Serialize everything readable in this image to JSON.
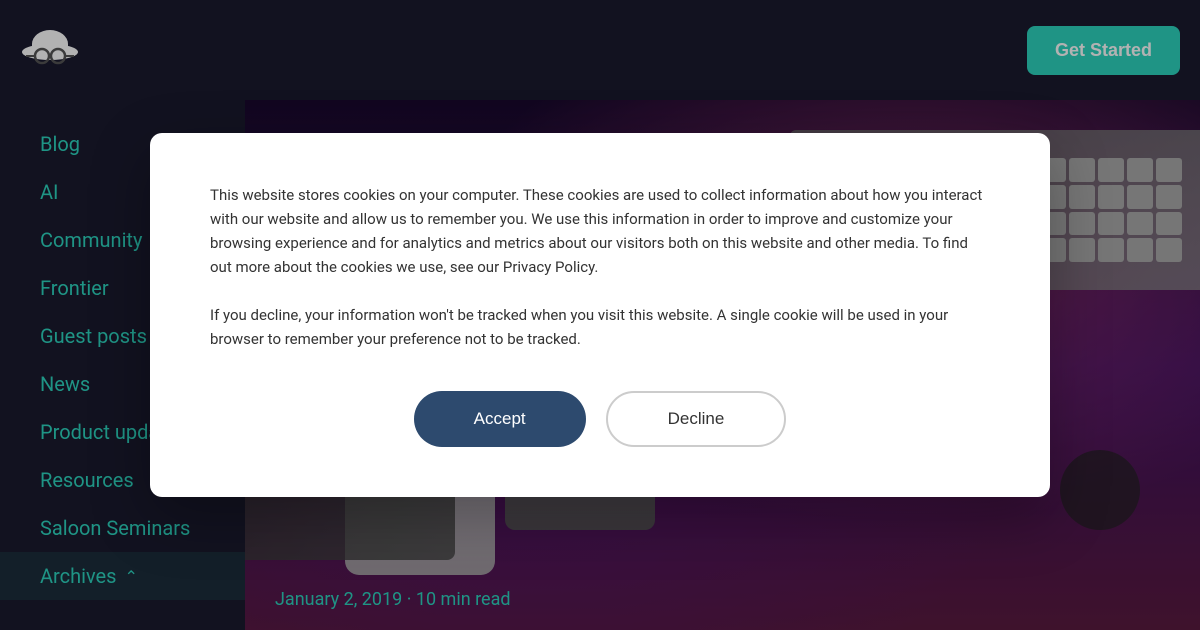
{
  "header": {
    "get_started_label": "Get Started"
  },
  "sidebar": {
    "items": [
      {
        "id": "blog",
        "label": "Blog"
      },
      {
        "id": "ai",
        "label": "AI"
      },
      {
        "id": "community",
        "label": "Community"
      },
      {
        "id": "frontier",
        "label": "Frontier"
      },
      {
        "id": "guest-posts",
        "label": "Guest posts"
      },
      {
        "id": "news",
        "label": "News"
      },
      {
        "id": "product-updates",
        "label": "Product updates"
      },
      {
        "id": "resources",
        "label": "Resources"
      },
      {
        "id": "saloon-seminars",
        "label": "Saloon Seminars"
      },
      {
        "id": "archives",
        "label": "Archives",
        "active": true
      }
    ]
  },
  "hero": {
    "date": "January 2, 2019",
    "read_time": "10 min read",
    "date_separator": "·"
  },
  "cookie_modal": {
    "text_1": "This website stores cookies on your computer. These cookies are used to collect information about how you interact with our website and allow us to remember you. We use this information in order to improve and customize your browsing experience and for analytics and metrics about our visitors both on this website and other media. To find out more about the cookies we use, see our Privacy Policy.",
    "text_2": "If you decline, your information won't be tracked when you visit this website. A single cookie will be used in your browser to remember your preference not to be tracked.",
    "accept_label": "Accept",
    "decline_label": "Decline"
  },
  "colors": {
    "accent": "#2dd4bf",
    "sidebar_bg": "#1a1a2e",
    "modal_bg": "#ffffff",
    "accept_btn_bg": "#2d4a6e"
  }
}
